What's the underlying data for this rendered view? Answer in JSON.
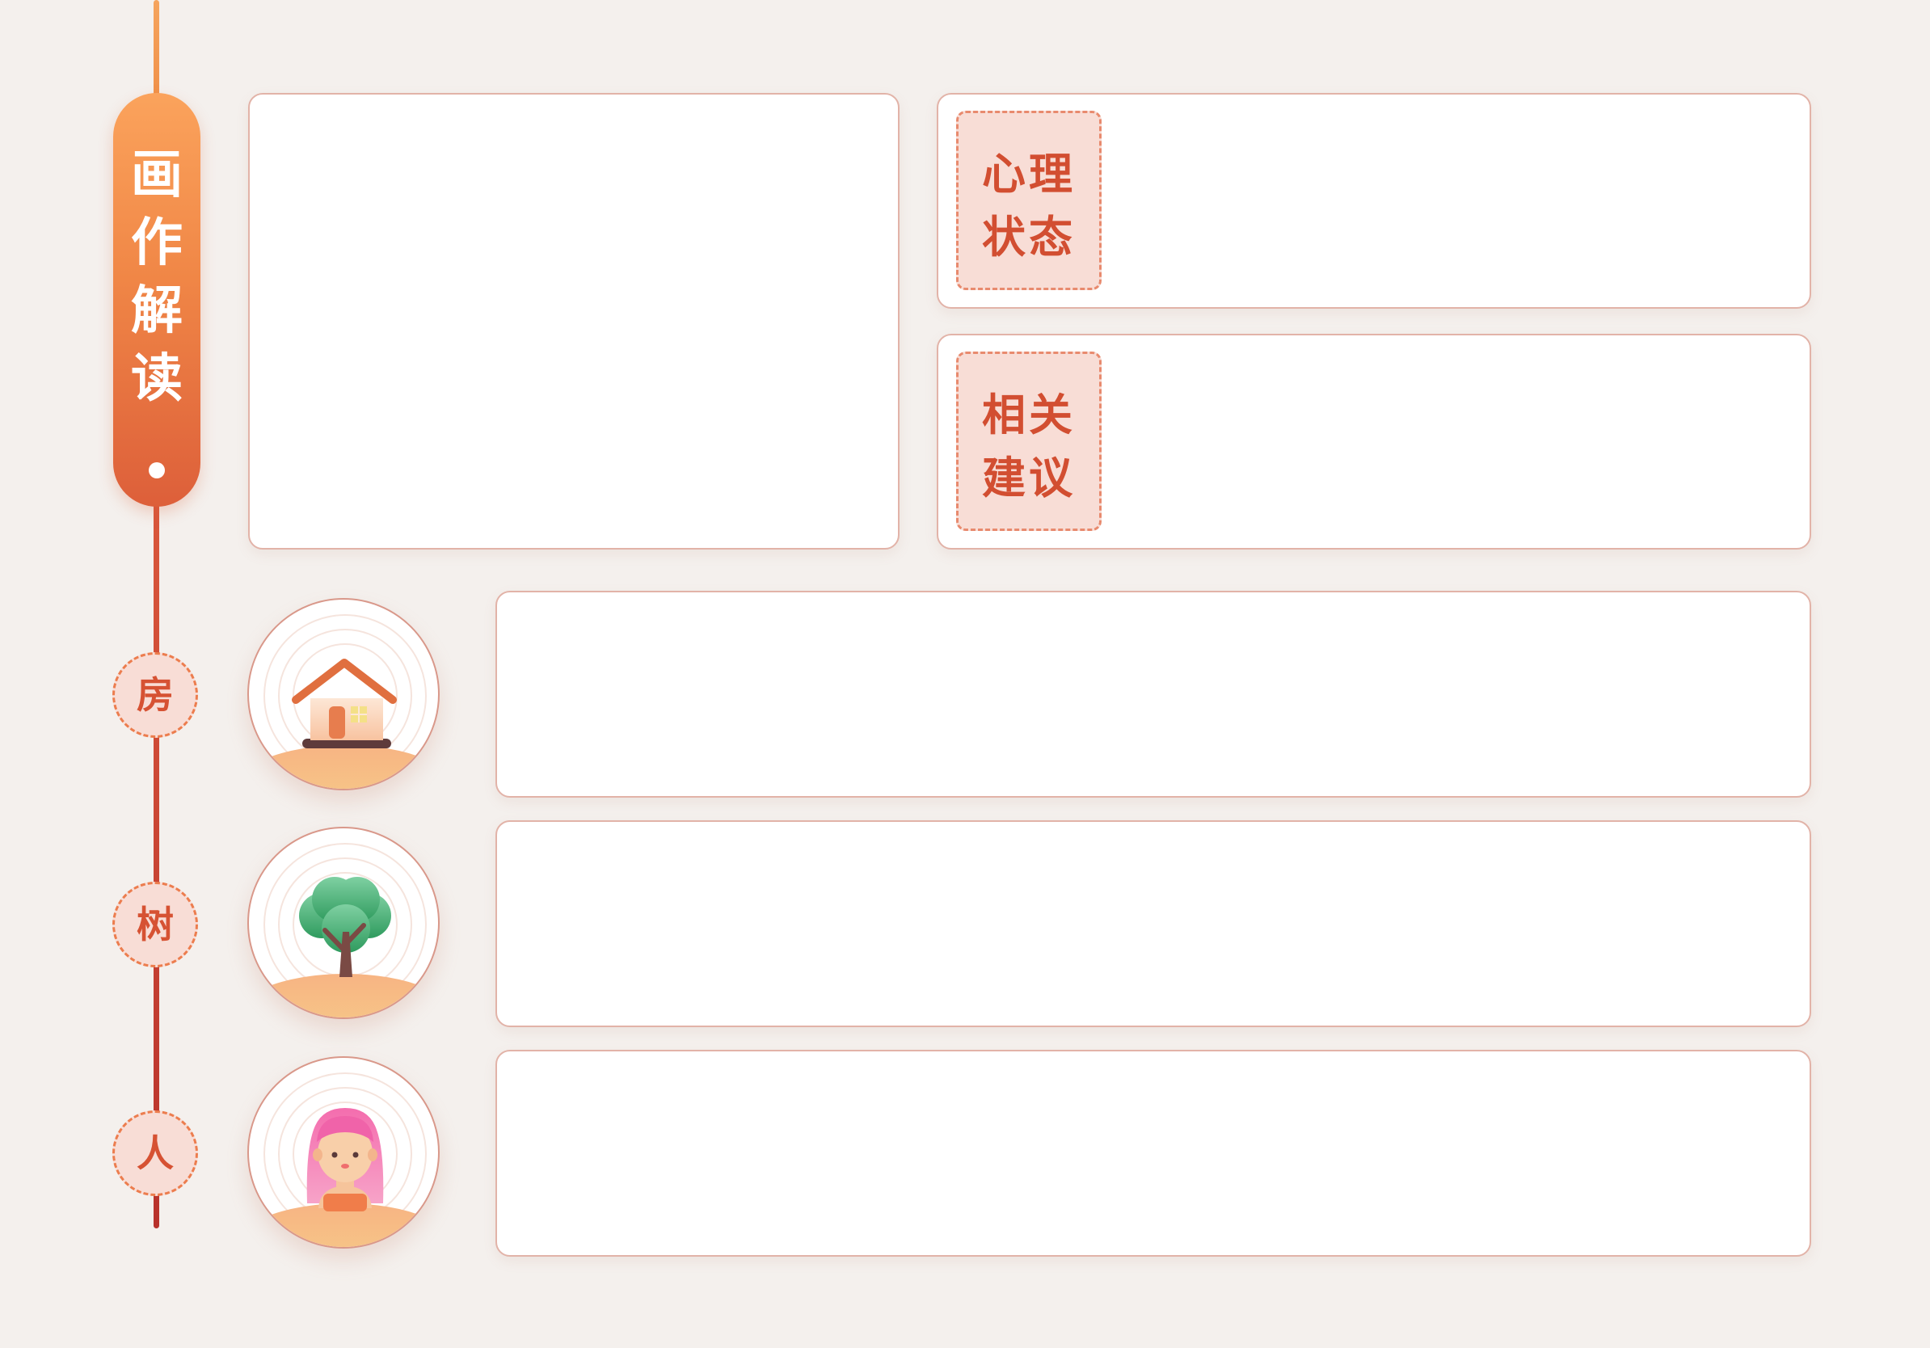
{
  "sidebar": {
    "title": "画作解读"
  },
  "summary": {
    "psych_state_label_line1": "心理",
    "psych_state_label_line2": "状态",
    "advice_label_line1": "相关",
    "advice_label_line2": "建议"
  },
  "sections": [
    {
      "label": "房",
      "icon": "house-icon"
    },
    {
      "label": "树",
      "icon": "tree-icon"
    },
    {
      "label": "人",
      "icon": "person-icon"
    }
  ],
  "colors": {
    "accent": "#f08646",
    "accent_dark": "#d24e31",
    "tag_bg": "#f8ddd6",
    "background": "#f4f0ed"
  }
}
